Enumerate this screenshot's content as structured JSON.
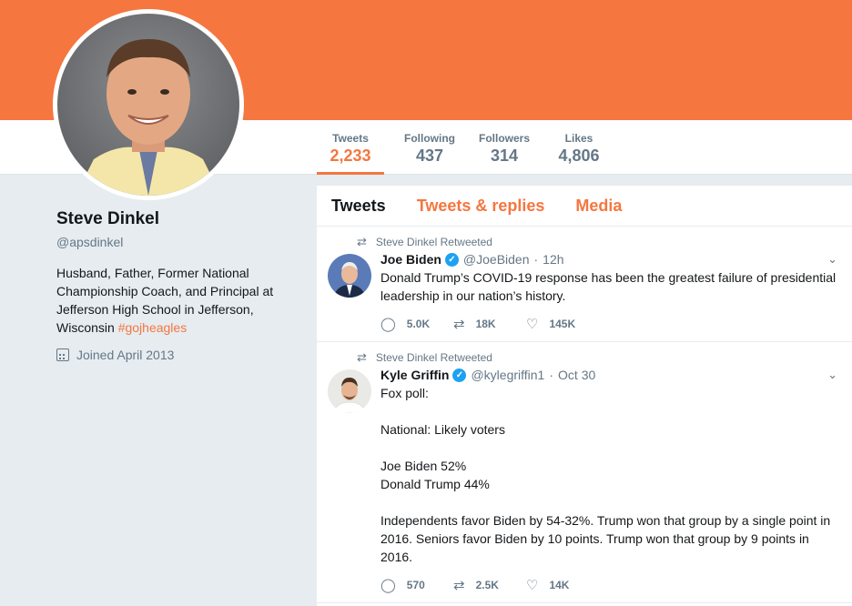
{
  "profile": {
    "name": "Steve Dinkel",
    "handle": "@apsdinkel",
    "bio_text": "Husband, Father, Former National Championship Coach, and Principal at Jefferson High School in Jefferson, Wisconsin ",
    "bio_hashtag": "#gojheagles",
    "joined": "Joined April 2013"
  },
  "stats": [
    {
      "label": "Tweets",
      "value": "2,233"
    },
    {
      "label": "Following",
      "value": "437"
    },
    {
      "label": "Followers",
      "value": "314"
    },
    {
      "label": "Likes",
      "value": "4,806"
    }
  ],
  "tabs": [
    "Tweets",
    "Tweets & replies",
    "Media"
  ],
  "tweets": [
    {
      "retweeted_by": "Steve Dinkel Retweeted",
      "name": "Joe Biden",
      "handle": "@JoeBiden",
      "time": "12h",
      "body": "Donald Trump’s COVID-19 response has been the greatest failure of presidential leadership in our nation’s history.",
      "replies": "5.0K",
      "retweets": "18K",
      "likes": "145K"
    },
    {
      "retweeted_by": "Steve Dinkel Retweeted",
      "name": "Kyle Griffin",
      "handle": "@kylegriffin1",
      "time": "Oct 30",
      "body": "Fox poll:\n\nNational: Likely voters\n\nJoe Biden 52%\nDonald Trump 44%\n\nIndependents favor Biden by 54-32%. Trump won that group by a single point in 2016. Seniors favor Biden by 10 points. Trump won that group by 9 points in 2016.",
      "replies": "570",
      "retweets": "2.5K",
      "likes": "14K"
    }
  ],
  "colors": {
    "accent": "#f5763f",
    "verified": "#1da1f2",
    "muted": "#657786"
  }
}
